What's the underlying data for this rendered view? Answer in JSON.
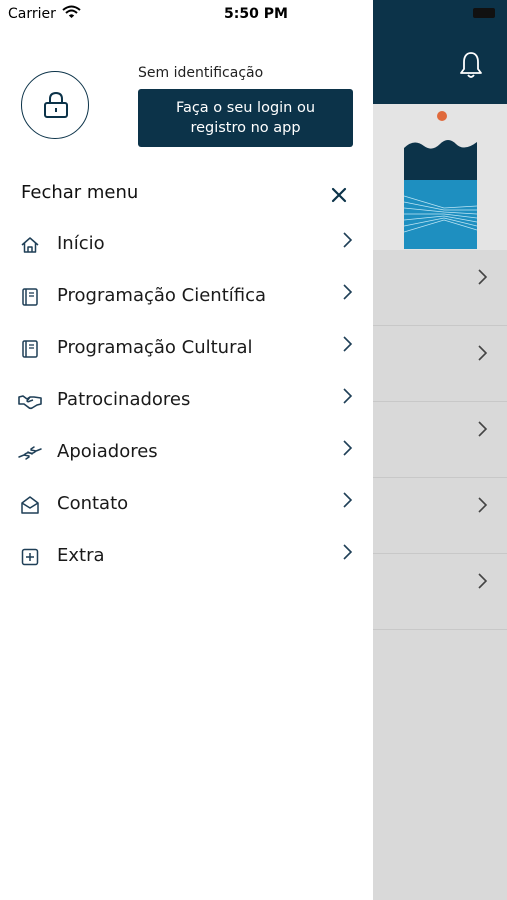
{
  "status_bar": {
    "carrier": "Carrier",
    "time": "5:50 PM"
  },
  "account": {
    "status_text": "Sem identificação",
    "login_button": "Faça o seu login ou\nregistro no app"
  },
  "drawer": {
    "close_label": "Fechar menu"
  },
  "menu": [
    {
      "label": "Início",
      "icon": "home-icon"
    },
    {
      "label": "Programação Científica",
      "icon": "book-icon"
    },
    {
      "label": "Programação Cultural",
      "icon": "book-icon"
    },
    {
      "label": "Patrocinadores",
      "icon": "handshake-icon"
    },
    {
      "label": "Apoiadores",
      "icon": "helping-hands-icon"
    },
    {
      "label": "Contato",
      "icon": "envelope-icon"
    },
    {
      "label": "Extra",
      "icon": "plus-box-icon"
    }
  ],
  "colors": {
    "primary": "#0c3349",
    "accent_dot": "#e06a3c",
    "background_dim": "#d9d9d9"
  }
}
